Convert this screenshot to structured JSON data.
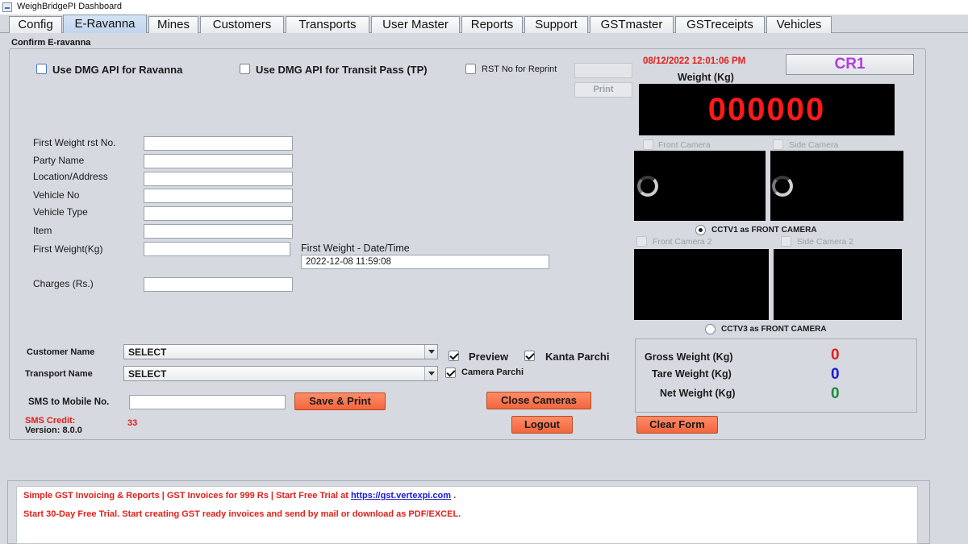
{
  "window": {
    "title": "WeighBridgePI Dashboard"
  },
  "tabs": [
    {
      "label": "Config"
    },
    {
      "label": "E-Ravanna"
    },
    {
      "label": "Mines"
    },
    {
      "label": "Customers"
    },
    {
      "label": "Transports"
    },
    {
      "label": "User Master"
    },
    {
      "label": "Reports"
    },
    {
      "label": "Support"
    },
    {
      "label": "GSTmaster"
    },
    {
      "label": "GSTreceipts"
    },
    {
      "label": "Vehicles"
    }
  ],
  "panel": {
    "caption": "Confirm E-ravanna",
    "use_dmg_ravanna": "Use DMG API for Ravanna",
    "use_dmg_tp": "Use DMG API for Transit Pass (TP)",
    "rst_reprint_label": "RST No for Reprint",
    "rst_reprint_value": "",
    "print_label": "Print"
  },
  "form": {
    "fields": [
      {
        "label": "First Weight rst No.",
        "value": ""
      },
      {
        "label": "Party Name",
        "value": ""
      },
      {
        "label": "Location/Address",
        "value": ""
      },
      {
        "label": "Vehicle No",
        "value": ""
      },
      {
        "label": "Vehicle Type",
        "value": ""
      },
      {
        "label": "Item",
        "value": ""
      },
      {
        "label": "First Weight(Kg)",
        "value": ""
      },
      {
        "label": "Charges (Rs.)",
        "value": ""
      }
    ],
    "first_weight_datetime_label": "First Weight - Date/Time",
    "first_weight_datetime_value": "2022-12-08 11:59:08"
  },
  "selectors": {
    "customer_label": "Customer Name",
    "customer_value": "SELECT",
    "transport_label": "Transport Name",
    "transport_value": "SELECT",
    "preview_label": "Preview",
    "kanta_label": "Kanta Parchi",
    "camera_parchi_label": "Camera Parchi",
    "sms_label": "SMS to Mobile No.",
    "sms_value": ""
  },
  "buttons": {
    "save_print": "Save & Print",
    "close_cameras": "Close Cameras",
    "logout": "Logout",
    "clear_form": "Clear Form"
  },
  "footer_info": {
    "sms_credit_label": "SMS Credit:",
    "sms_credit_value": "33",
    "version": "Version: 8.0.0"
  },
  "weighing": {
    "datetime": "08/12/2022 12:01:06 PM",
    "station": "CR1",
    "weight_label": "Weight (Kg)",
    "weight_value": "000000",
    "front_camera": "Front Camera",
    "side_camera": "Side Camera",
    "cctv1_label": "CCTV1 as FRONT CAMERA",
    "front_camera_2": "Front Camera 2",
    "side_camera_2": "Side Camera 2",
    "cctv3_label": "CCTV3 as FRONT CAMERA"
  },
  "summary": {
    "gross_label": "Gross Weight  (Kg)",
    "gross_value": "0",
    "tare_label": "Tare Weight  (Kg)",
    "tare_value": "0",
    "net_label": "Net Weight (Kg)",
    "net_value": "0"
  },
  "banner": {
    "line1_text": "Simple GST Invoicing & Reports | GST Invoices for 999 Rs | Start Free Trial at ",
    "line1_link": "https://gst.vertexpi.com",
    "line1_tail": " .",
    "line2": "Start 30-Day Free Trial. Start creating GST ready invoices and send by mail or download as PDF/EXCEL."
  },
  "colors": {
    "datetime": "#e0201b",
    "station": "#b43be0",
    "weight_display": "#ff1a1a",
    "gross": "#e0201b",
    "tare": "#1a1ad8",
    "net": "#1e8a3a",
    "button": "#f2663d"
  }
}
